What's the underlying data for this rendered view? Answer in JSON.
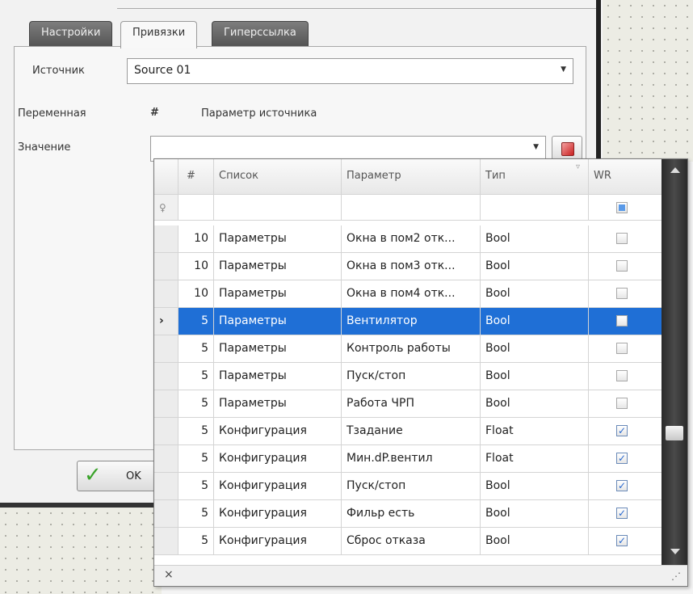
{
  "tabs": [
    {
      "label": "Настройки",
      "active": false
    },
    {
      "label": "Привязки",
      "active": true
    },
    {
      "label": "Гиперссылка",
      "active": false
    }
  ],
  "form": {
    "source_label": "Источник",
    "source_value": "Source 01",
    "variable_label": "Переменная",
    "hash_label": "#",
    "source_param_label": "Параметр источника",
    "value_label": "Значение",
    "value_value": ""
  },
  "ok_label": "OK",
  "grid": {
    "columns": {
      "num": "#",
      "list": "Список",
      "param": "Параметр",
      "type": "Тип",
      "wr": "WR"
    },
    "rows": [
      {
        "num": "10",
        "list": "Параметры",
        "param": "Окна в пом2 отк...",
        "type": "Bool",
        "wr": false
      },
      {
        "num": "10",
        "list": "Параметры",
        "param": "Окна в пом3 отк...",
        "type": "Bool",
        "wr": false
      },
      {
        "num": "10",
        "list": "Параметры",
        "param": "Окна в пом4 отк...",
        "type": "Bool",
        "wr": false
      },
      {
        "num": "5",
        "list": "Параметры",
        "param": "Вентилятор",
        "type": "Bool",
        "wr": false,
        "selected": true
      },
      {
        "num": "5",
        "list": "Параметры",
        "param": "Контроль работы",
        "type": "Bool",
        "wr": false
      },
      {
        "num": "5",
        "list": "Параметры",
        "param": "Пуск/стоп",
        "type": "Bool",
        "wr": false
      },
      {
        "num": "5",
        "list": "Параметры",
        "param": "Работа ЧРП",
        "type": "Bool",
        "wr": false
      },
      {
        "num": "5",
        "list": "Конфигурация",
        "param": "Тзадание",
        "type": "Float",
        "wr": true
      },
      {
        "num": "5",
        "list": "Конфигурация",
        "param": "Мин.dP.вентил",
        "type": "Float",
        "wr": true
      },
      {
        "num": "5",
        "list": "Конфигурация",
        "param": "Пуск/стоп",
        "type": "Bool",
        "wr": true
      },
      {
        "num": "5",
        "list": "Конфигурация",
        "param": "Фильр есть",
        "type": "Bool",
        "wr": true
      },
      {
        "num": "5",
        "list": "Конфигурация",
        "param": "Сброс отказа",
        "type": "Bool",
        "wr": true
      }
    ]
  },
  "icons": {
    "row_indicator": "›",
    "filter": "filter-icon",
    "clear_filter": "×",
    "resize_grip": "resize-grip-icon",
    "check": "✓"
  },
  "colors": {
    "selection": "#1f6fd6",
    "ok_check": "#3aa32a"
  }
}
